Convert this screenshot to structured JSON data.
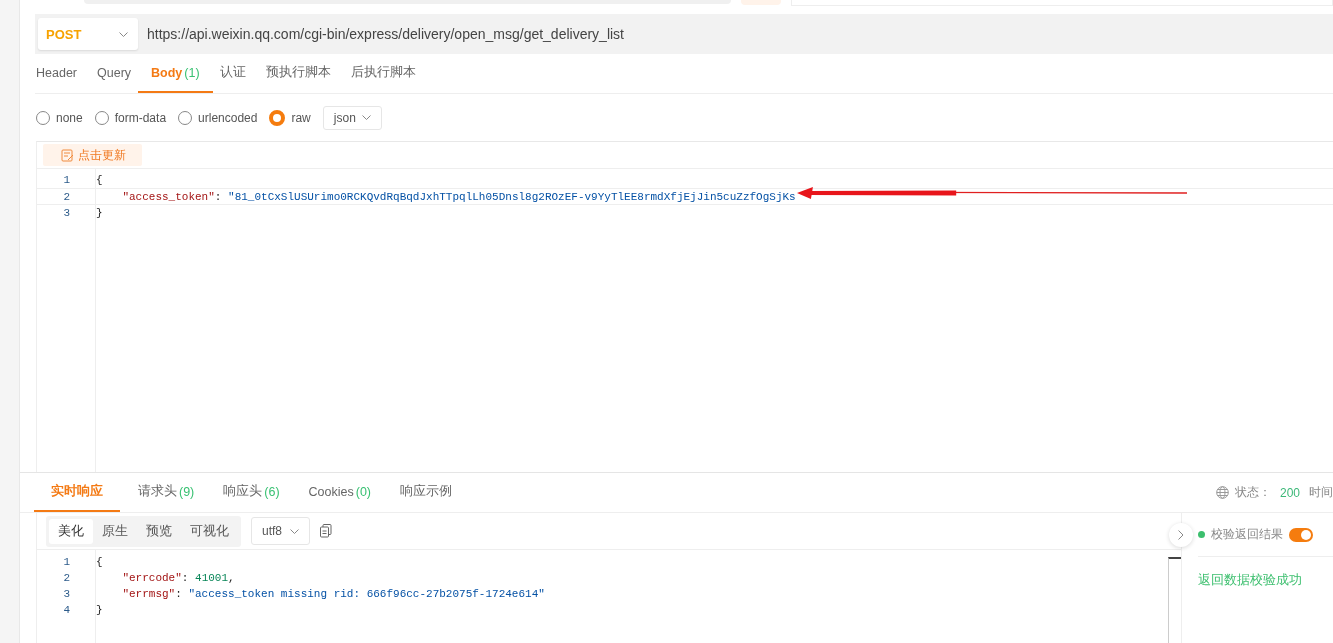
{
  "request": {
    "method": "POST",
    "url": "https://api.weixin.qq.com/cgi-bin/express/delivery/open_msg/get_delivery_list"
  },
  "request_tabs": [
    {
      "label": "Header",
      "selected": false
    },
    {
      "label": "Query",
      "selected": false
    },
    {
      "label": "Body",
      "count": "(1)",
      "selected": true
    },
    {
      "label": "认证",
      "selected": false
    },
    {
      "label": "预执行脚本",
      "selected": false
    },
    {
      "label": "后执行脚本",
      "selected": false
    }
  ],
  "body_types": [
    {
      "label": "none",
      "selected": false
    },
    {
      "label": "form-data",
      "selected": false
    },
    {
      "label": "urlencoded",
      "selected": false
    },
    {
      "label": "raw",
      "selected": true
    }
  ],
  "body_format": "json",
  "editor": {
    "update_button": "点击更新",
    "lines": [
      {
        "number": "1",
        "tokens": [
          {
            "kind": "punct",
            "text": "{"
          }
        ]
      },
      {
        "number": "2",
        "tokens": [
          {
            "kind": "key",
            "text": "    \"access_token\""
          },
          {
            "kind": "punct",
            "text": ": "
          },
          {
            "kind": "string",
            "text": "\"81_0tCxSlUSUrimo0RCKQvdRqBqdJxhTTpqlLh05Dnsl8g2ROzEF-v9YyTlEE8rmdXfjEjJin5cuZzfOgSjKs"
          }
        ]
      },
      {
        "number": "3",
        "tokens": [
          {
            "kind": "punct",
            "text": "}"
          }
        ]
      }
    ]
  },
  "response_tabs": [
    {
      "label": "实时响应",
      "selected": true
    },
    {
      "label": "请求头",
      "count": "(9)",
      "selected": false
    },
    {
      "label": "响应头",
      "count": "(6)",
      "selected": false
    },
    {
      "label": "Cookies",
      "count": "(0)",
      "selected": false
    },
    {
      "label": "响应示例",
      "selected": false
    }
  ],
  "status": {
    "label": "状态：",
    "code": "200",
    "time_label": "时间"
  },
  "view_modes": [
    {
      "label": "美化",
      "selected": true
    },
    {
      "label": "原生",
      "selected": false
    },
    {
      "label": "预览",
      "selected": false
    },
    {
      "label": "可视化",
      "selected": false
    }
  ],
  "encoding": "utf8",
  "response_lines": [
    {
      "number": "1",
      "tokens": [
        {
          "kind": "punct",
          "text": "{"
        }
      ]
    },
    {
      "number": "2",
      "tokens": [
        {
          "kind": "key",
          "text": "    \"errcode\""
        },
        {
          "kind": "punct",
          "text": ": "
        },
        {
          "kind": "number",
          "text": "41001"
        },
        {
          "kind": "punct",
          "text": ","
        }
      ]
    },
    {
      "number": "3",
      "tokens": [
        {
          "kind": "key",
          "text": "    \"errmsg\""
        },
        {
          "kind": "punct",
          "text": ": "
        },
        {
          "kind": "string",
          "text": "\"access_token missing rid: 666f96cc-27b2075f-1724e614\""
        }
      ]
    },
    {
      "number": "4",
      "tokens": [
        {
          "kind": "punct",
          "text": "}"
        }
      ]
    }
  ],
  "validation": {
    "label": "校验返回结果",
    "on": true,
    "result": "返回数据校验成功"
  }
}
